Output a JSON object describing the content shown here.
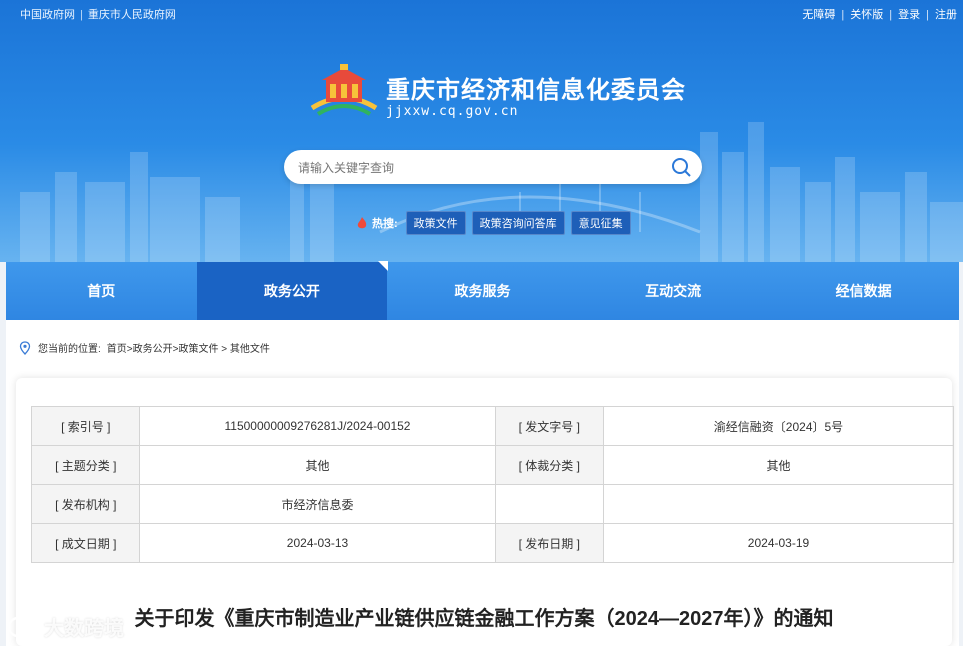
{
  "top_links": [
    "中国政府网",
    "重庆市人民政府网"
  ],
  "top_right_links": [
    "无障碍",
    "关怀版",
    "登录",
    "注册"
  ],
  "site": {
    "title": "重庆市经济和信息化委员会",
    "domain": "jjxxw.cq.gov.cn"
  },
  "search": {
    "placeholder": "请输入关键字查询"
  },
  "hot": {
    "label": "热搜:",
    "tags": [
      "政策文件",
      "政策咨询问答库",
      "意见征集"
    ]
  },
  "nav": [
    {
      "label": "首页",
      "active": false
    },
    {
      "label": "政务公开",
      "active": true
    },
    {
      "label": "政务服务",
      "active": false
    },
    {
      "label": "互动交流",
      "active": false
    },
    {
      "label": "经信数据",
      "active": false
    }
  ],
  "breadcrumb": {
    "prefix": "您当前的位置:",
    "path": "首页>政务公开>政策文件 > 其他文件"
  },
  "meta": [
    [
      "[ 索引号 ]",
      "11500000009276281J/2024-00152",
      "[ 发文字号 ]",
      "渝经信融资〔2024〕5号"
    ],
    [
      "[ 主题分类 ]",
      "其他",
      "[ 体裁分类 ]",
      "其他"
    ],
    [
      "[ 发布机构 ]",
      "市经济信息委",
      "",
      ""
    ],
    [
      "[ 成文日期 ]",
      "2024-03-13",
      "[ 发布日期 ]",
      "2024-03-19"
    ]
  ],
  "doc_title": "关于印发《重庆市制造业产业链供应链金融工作方案（2024—2027年）》的通知",
  "watermark": "大数跨境",
  "colors": {
    "nav_bg": "#3f98ec",
    "nav_active": "#1a63c4",
    "hero_top": "#1b74d7"
  }
}
